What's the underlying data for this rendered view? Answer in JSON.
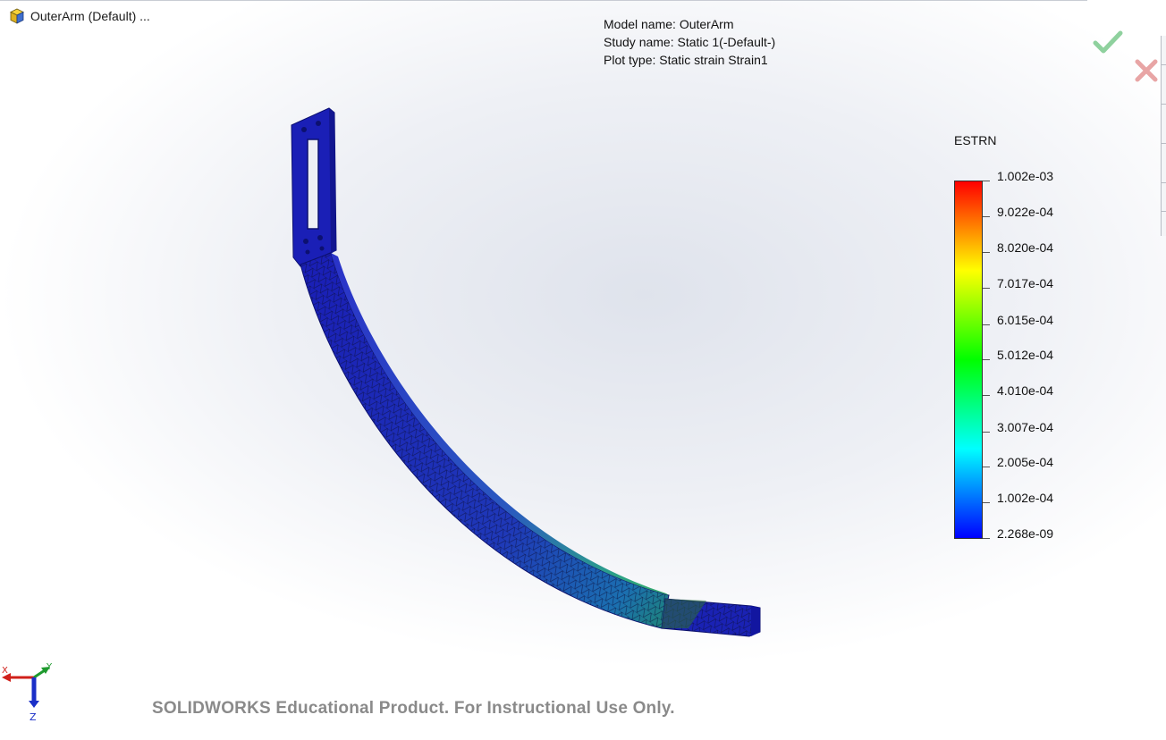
{
  "window": {
    "document_title": "OuterArm (Default) ..."
  },
  "study_info": {
    "model_name": "Model name: OuterArm",
    "study_name": "Study name: Static 1(-Default-)",
    "plot_type": "Plot type: Static strain Strain1"
  },
  "legend": {
    "title": "ESTRN",
    "labels": [
      "1.002e-03",
      "9.022e-04",
      "8.020e-04",
      "7.017e-04",
      "6.015e-04",
      "5.012e-04",
      "4.010e-04",
      "3.007e-04",
      "2.005e-04",
      "1.002e-04",
      "2.268e-09"
    ],
    "colors": [
      "#ff0000",
      "#ff8000",
      "#ffff00",
      "#80ff00",
      "#00ff00",
      "#00ff80",
      "#00ffff",
      "#0080ff",
      "#0000ff"
    ]
  },
  "triad": {
    "x": "X",
    "y": "Y",
    "z": "Z"
  },
  "watermark": "SOLIDWORKS Educational Product. For Instructional Use Only.",
  "icons": {
    "ok": "checkmark-icon",
    "cancel": "close-icon",
    "part": "part-icon"
  },
  "colors": {
    "accent_ok": "#8fd19e",
    "accent_cancel": "#e8a5a5",
    "mesh_blue": "#1c24b8"
  }
}
